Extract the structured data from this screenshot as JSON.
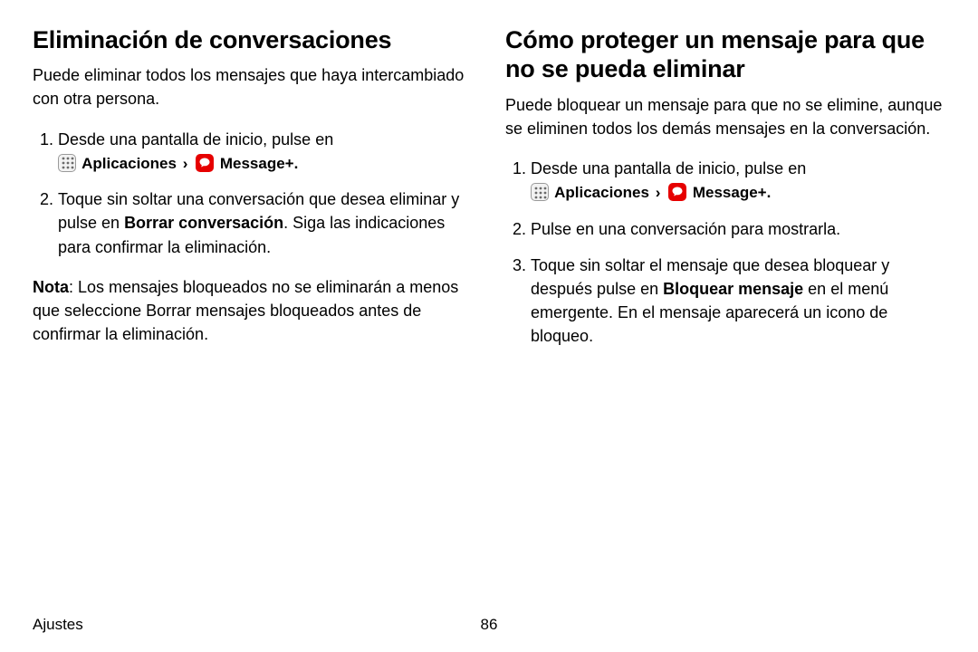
{
  "left": {
    "title": "Eliminación de conversaciones",
    "intro": "Puede eliminar todos los mensajes que haya intercambiado con otra persona.",
    "step1_pre": "Desde una pantalla de inicio, pulse en ",
    "apps_label": "Aplicaciones",
    "chevron": "›",
    "msg_label": "Message+",
    "step1_post": ".",
    "step2_a": "Toque sin soltar una conversación que desea eliminar y pulse en ",
    "step2_bold": "Borrar conversación",
    "step2_b": ". Siga las indicaciones para confirmar la eliminación.",
    "note_label": "Nota",
    "note_body": ": Los mensajes bloqueados no se eliminarán a menos que seleccione Borrar mensajes bloqueados antes de confirmar la eliminación."
  },
  "right": {
    "title": "Cómo proteger un mensaje para que no se pueda eliminar",
    "intro": "Puede bloquear un mensaje para que no se elimine, aunque se eliminen todos los demás mensajes en la conversación.",
    "step1_pre": "Desde una pantalla de inicio, pulse en ",
    "apps_label": "Aplicaciones",
    "chevron": "›",
    "msg_label": "Message+",
    "step1_post": ".",
    "step2": "Pulse en una conversación para mostrarla.",
    "step3_a": "Toque sin soltar el mensaje que desea bloquear y después pulse en ",
    "step3_bold": "Bloquear mensaje",
    "step3_b": " en el menú emergente. En el mensaje aparecerá un icono de bloqueo."
  },
  "footer": {
    "section": "Ajustes",
    "page": "86"
  }
}
